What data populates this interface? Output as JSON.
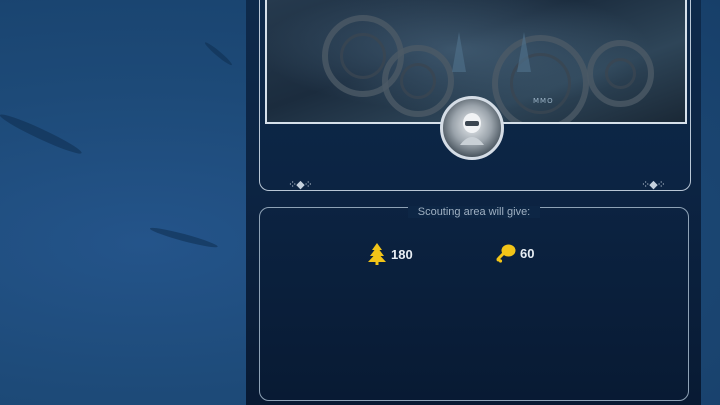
{
  "scouting": {
    "title": "Scouting area will give:",
    "art_caption": "MMO",
    "rewards": [
      {
        "icon": "tree-icon",
        "value": "180"
      },
      {
        "icon": "food-drumstick-icon",
        "value": "60"
      }
    ]
  },
  "colors": {
    "resource_gold": "#f2c418",
    "frame": "#b9c7d6",
    "panel": "#0c2443"
  }
}
